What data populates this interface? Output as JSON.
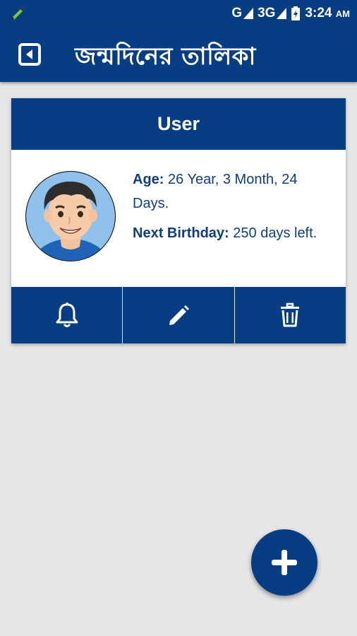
{
  "status_bar": {
    "network_1": "G",
    "network_2": "3G",
    "time": "3:24",
    "ampm": "AM",
    "icons": [
      "pen-notification-icon",
      "signal-icon",
      "battery-charging-icon"
    ]
  },
  "app_bar": {
    "title": "জন্মদিনের তালিকা",
    "back_icon": "back-square-icon"
  },
  "card": {
    "name": "User",
    "age_label": "Age:",
    "age_value": "26 Year, 3 Month, 24 Days.",
    "next_label": "Next Birthday:",
    "next_value": "250 days left.",
    "actions": [
      {
        "name": "reminder",
        "icon": "bell-icon"
      },
      {
        "name": "edit",
        "icon": "pencil-icon"
      },
      {
        "name": "delete",
        "icon": "trash-icon"
      }
    ]
  },
  "fab": {
    "icon": "plus-icon"
  },
  "colors": {
    "primary": "#073d83",
    "background": "#e6e6e6",
    "text_blue": "#0f3d80"
  }
}
